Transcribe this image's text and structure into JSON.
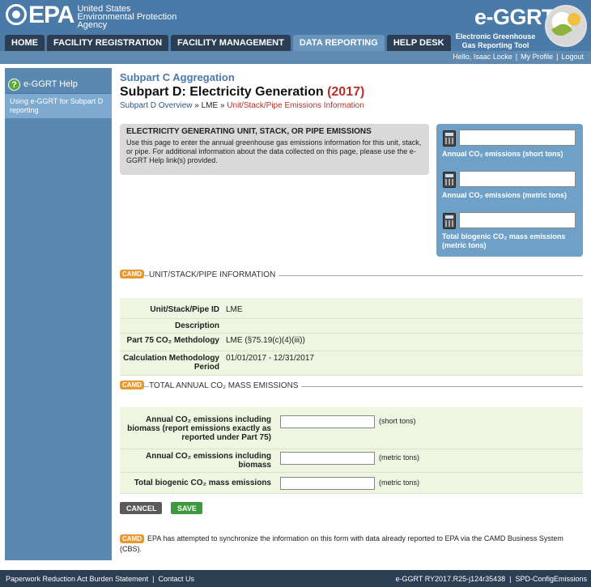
{
  "header": {
    "epa_mark": "EPA",
    "agency_lines": [
      "United States",
      "Environmental Protection",
      "Agency"
    ],
    "app_title": "e-GGRT",
    "app_subtitle": "Electronic Greenhouse Gas Reporting Tool"
  },
  "tabs": [
    {
      "label": "HOME"
    },
    {
      "label": "FACILITY REGISTRATION"
    },
    {
      "label": "FACILITY MANAGEMENT"
    },
    {
      "label": "DATA REPORTING"
    },
    {
      "label": "HELP DESK"
    }
  ],
  "user": {
    "greeting": "Hello, Isaac Locke",
    "profile": "My Profile",
    "logout": "Logout"
  },
  "sidebar": {
    "help_label": "e-GGRT Help",
    "item": "Using e-GGRT for Subpart D reporting"
  },
  "page": {
    "aggregation": "Subpart C Aggregation",
    "title": "Subpart D: Electricity Generation",
    "year": "(2017)",
    "crumb_1": "Subpart D Overview",
    "crumb_sep": "»",
    "crumb_2": "LME",
    "crumb_3": "Unit/Stack/Pipe Emissions Information"
  },
  "info": {
    "title": "ELECTRICITY GENERATING UNIT, STACK, OR PIPE EMISSIONS",
    "text": "Use this page to enter the annual greenhouse gas emissions information for this unit, stack, or pipe. For additional information about the data collected on this page, please use the e-GGRT Help link(s) provided."
  },
  "calculators": [
    {
      "label": "Annual CO₂ emissions (short tons)"
    },
    {
      "label": "Annual CO₂ emissions (metric tons)"
    },
    {
      "label": "Total biogenic CO₂ mass emissions (metric tons)"
    }
  ],
  "camd_badge": "CAMD",
  "unit_section": {
    "title": "UNIT/STACK/PIPE INFORMATION",
    "rows": [
      {
        "label": "Unit/Stack/Pipe ID",
        "value": "LME"
      },
      {
        "label": "Description",
        "value": ""
      },
      {
        "label": "Part 75 CO₂ Methdology",
        "value": "LME (§75.19(c)(4)(iii))"
      },
      {
        "label": "Calculation Methodology Period",
        "value": "01/01/2017 - 12/31/2017"
      }
    ]
  },
  "emissions_section": {
    "title": "TOTAL ANNUAL CO₂ MASS EMISSIONS",
    "rows": [
      {
        "label": "Annual CO₂ emissions including biomass (report emissions exactly as reported under Part 75)",
        "unit": "(short tons)",
        "value": ""
      },
      {
        "label": "Annual CO₂ emissions including biomass",
        "unit": "(metric tons)",
        "value": ""
      },
      {
        "label": "Total biogenic CO₂ mass emissions",
        "unit": "(metric tons)",
        "value": ""
      }
    ]
  },
  "buttons": {
    "cancel": "CANCEL",
    "save": "SAVE"
  },
  "sync_note": "EPA has attempted to synchronize the information on this form with data already reported to EPA via the CAMD Business System (CBS).",
  "footer": {
    "burden": "Paperwork Reduction Act Burden Statement",
    "contact": "Contact Us",
    "version": "e-GGRT RY2017.R25-j124r35438",
    "config": "SPD-ConfigEmissions"
  }
}
